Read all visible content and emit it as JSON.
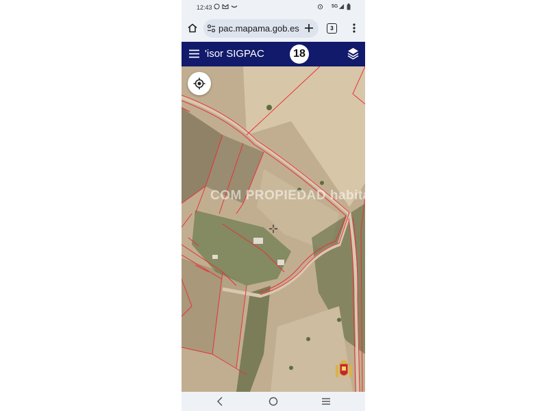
{
  "status_bar": {
    "time": "12:43",
    "left_icons": [
      "whatsapp-icon",
      "gmail-icon",
      "phone-link-icon"
    ],
    "right_icons": [
      "alarm-icon",
      "5g-icon",
      "signal-icon",
      "battery-icon"
    ],
    "network": "5G"
  },
  "browser": {
    "url": "pac.mapama.gob.es",
    "tab_count": "3",
    "icons": [
      "home-icon",
      "site-settings-icon",
      "new-tab-icon",
      "tab-switcher-icon",
      "more-menu-icon"
    ]
  },
  "app_bar": {
    "title": "'isor SIGPAC",
    "zoom_level": "18",
    "icons": [
      "menu-icon",
      "layers-icon"
    ],
    "background_color": "#121a6b"
  },
  "map": {
    "watermark": "COM PROPIEDAD habitaclia",
    "parcel_line_color": "#e8303a",
    "icons": [
      "locate-icon",
      "crosshair-icon",
      "spain-crest-icon"
    ]
  },
  "nav_bar": {
    "icons": [
      "back-icon",
      "home-button-icon",
      "recents-icon"
    ]
  }
}
